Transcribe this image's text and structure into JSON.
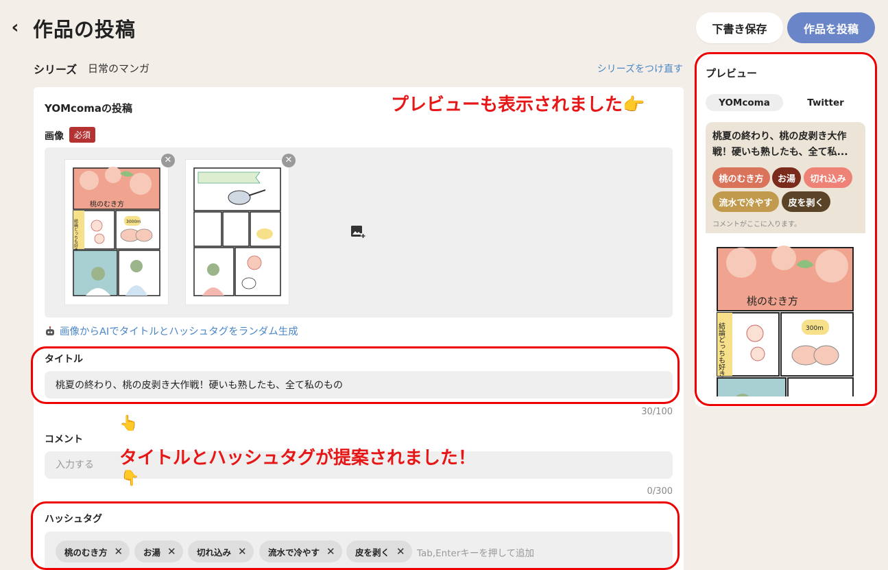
{
  "header": {
    "back_icon": "chevron-left-icon",
    "title": "作品の投稿",
    "draft_label": "下書き保存",
    "post_label": "作品を投稿"
  },
  "series": {
    "label": "シリーズ",
    "value": "日常のマンガ",
    "reassign_link": "シリーズをつけ直す"
  },
  "form": {
    "card_title": "YOMcomaの投稿",
    "image_label": "画像",
    "required_badge": "必須",
    "ai_generate_link": "画像からAIでタイトルとハッシュタグをランダム生成",
    "title_label": "タイトル",
    "title_value": "桃夏の終わり、桃の皮剥き大作戦！硬いも熟したも、全て私のもの",
    "title_count": "30/100",
    "comment_label": "コメント",
    "comment_placeholder": "入力する",
    "comment_count": "0/300",
    "hashtag_label": "ハッシュタグ",
    "hashtags": [
      "桃のむき方",
      "お湯",
      "切れ込み",
      "流水で冷やす",
      "皮を剥く"
    ],
    "hashtag_placeholder": "Tab,Enterキーを押して追加"
  },
  "thumb_texts": {
    "thumb1_title": "桃のむき方",
    "thumb1_side": "結論どっちも好き",
    "thumb1_note": "3000m"
  },
  "preview": {
    "title": "プレビュー",
    "tabs": [
      "YOMcoma",
      "Twitter"
    ],
    "active_tab": "YOMcoma",
    "text": "桃夏の終わり、桃の皮剥き大作戦！硬いも熟したも、全て私...",
    "tags": [
      {
        "label": "桃のむき方",
        "color": "#d9735a"
      },
      {
        "label": "お湯",
        "color": "#7a2b1b"
      },
      {
        "label": "切れ込み",
        "color": "#ef8276"
      },
      {
        "label": "流水で冷やす",
        "color": "#c19a4d"
      },
      {
        "label": "皮を剥く",
        "color": "#5a4327"
      }
    ],
    "comment_placeholder": "コメントがここに入ります。",
    "image_title": "桃のむき方",
    "image_side": "結論どっちも好き",
    "image_note": "300m"
  },
  "annotations": {
    "preview_note": "プレビューも表示されました👉",
    "suggest_note": "タイトルとハッシュタグが提案されました！",
    "hand_up": "👆",
    "hand_down": "👇"
  },
  "colors": {
    "accent": "#6b86c8",
    "link": "#4a86c8",
    "annotation": "#e61616",
    "required": "#b53232"
  }
}
